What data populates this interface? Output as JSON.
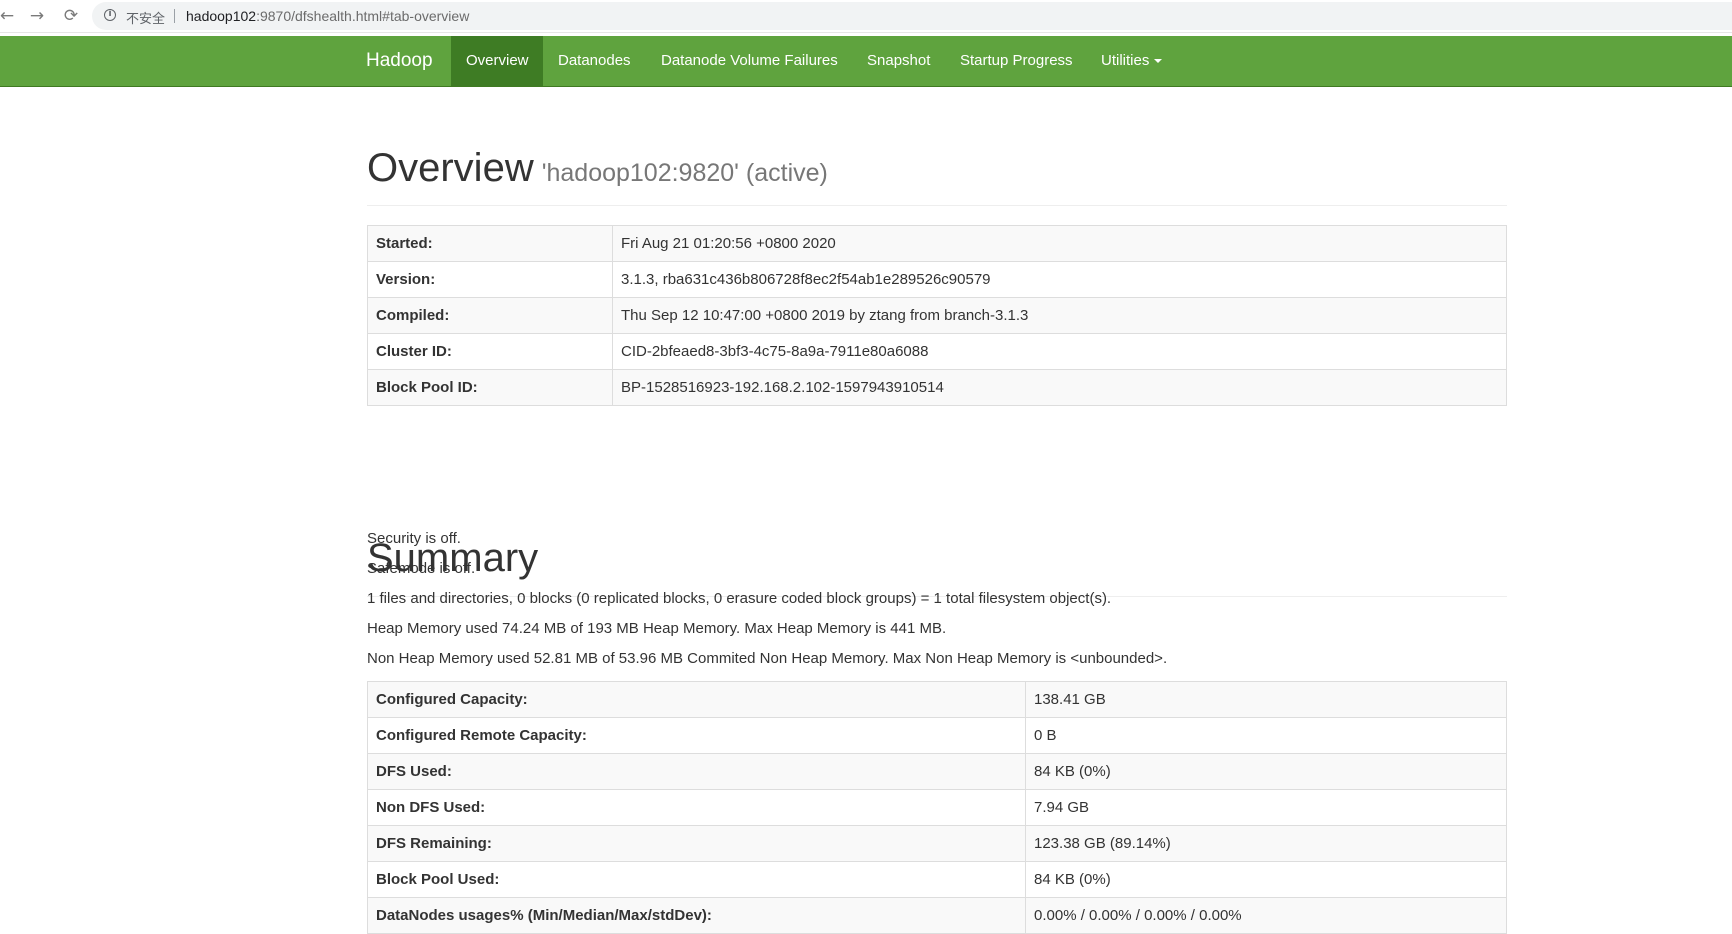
{
  "browser": {
    "security_label": "不安全",
    "url_host": "hadoop102",
    "url_rest": ":9870/dfshealth.html#tab-overview"
  },
  "navbar": {
    "brand": "Hadoop",
    "items": [
      {
        "label": "Overview",
        "active": true
      },
      {
        "label": "Datanodes"
      },
      {
        "label": "Datanode Volume Failures"
      },
      {
        "label": "Snapshot"
      },
      {
        "label": "Startup Progress"
      },
      {
        "label": "Utilities"
      }
    ]
  },
  "overview": {
    "title": "Overview",
    "subtitle": "'hadoop102:9820' (active)",
    "rows": [
      {
        "key": "Started:",
        "value": "Fri Aug 21 01:20:56 +0800 2020"
      },
      {
        "key": "Version:",
        "value": "3.1.3, rba631c436b806728f8ec2f54ab1e289526c90579"
      },
      {
        "key": "Compiled:",
        "value": "Thu Sep 12 10:47:00 +0800 2019 by ztang from branch-3.1.3"
      },
      {
        "key": "Cluster ID:",
        "value": "CID-2bfeaed8-3bf3-4c75-8a9a-7911e80a6088"
      },
      {
        "key": "Block Pool ID:",
        "value": "BP-1528516923-192.168.2.102-1597943910514"
      }
    ]
  },
  "summary": {
    "title": "Summary",
    "lines": [
      "Security is off.",
      "Safemode is off.",
      "1 files and directories, 0 blocks (0 replicated blocks, 0 erasure coded block groups) = 1 total filesystem object(s).",
      "Heap Memory used 74.24 MB of 193 MB Heap Memory. Max Heap Memory is 441 MB.",
      "Non Heap Memory used 52.81 MB of 53.96 MB Commited Non Heap Memory. Max Non Heap Memory is <unbounded>."
    ],
    "rows": [
      {
        "key": "Configured Capacity:",
        "value": "138.41 GB"
      },
      {
        "key": "Configured Remote Capacity:",
        "value": "0 B"
      },
      {
        "key": "DFS Used:",
        "value": "84 KB (0%)"
      },
      {
        "key": "Non DFS Used:",
        "value": "7.94 GB"
      },
      {
        "key": "DFS Remaining:",
        "value": "123.38 GB (89.14%)"
      },
      {
        "key": "Block Pool Used:",
        "value": "84 KB (0%)"
      },
      {
        "key": "DataNodes usages% (Min/Median/Max/stdDev):",
        "value": "0.00% / 0.00% / 0.00% / 0.00%"
      }
    ]
  },
  "colors": {
    "navbar": "#5fa33e",
    "navbar_active": "#3e7c24",
    "table_border": "#dddddd",
    "stripe": "#f9f9f9"
  }
}
